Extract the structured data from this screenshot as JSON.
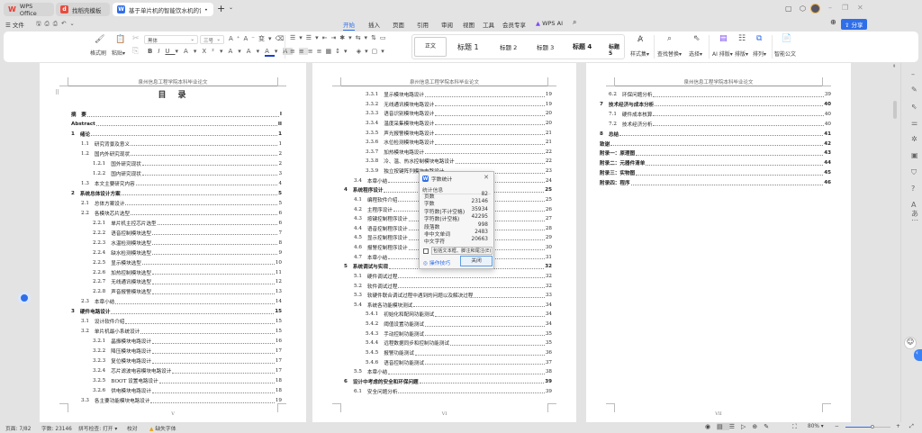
{
  "tabs": [
    {
      "label": "WPS Office",
      "icon": "wps-logo-icon",
      "color": "#e8392e"
    },
    {
      "label": "找稻壳模板",
      "icon": "docer-icon",
      "color": "#e84c3d"
    },
    {
      "label": "基于单片机的智能饮水机的设计",
      "icon": "word-doc-icon",
      "color": "#2f6ee8"
    }
  ],
  "menu": {
    "file": "文件",
    "tabs": [
      "开始",
      "插入",
      "页面",
      "引用",
      "审阅",
      "视图",
      "工具",
      "会员专享",
      "WPS AI"
    ],
    "active": "开始",
    "share": "分享"
  },
  "ribbon": {
    "format_painter": "格式刷",
    "paste": "粘贴",
    "font": "黑体",
    "size": "三号",
    "styles": [
      "正文",
      "标题 1",
      "标题 2",
      "标题 3",
      "标题 4",
      "标题 5"
    ],
    "style_set": "样式集",
    "find_replace": "查找替换",
    "select": "选择",
    "ai_layout": "AI 排版",
    "layout": "排版",
    "arrange": "排列",
    "smart_doc": "智能公文"
  },
  "doc": {
    "header": "泉州信息工程学院本科毕业论文",
    "toc_title": "目　录",
    "pages": [
      {
        "footer": "V",
        "rows": [
          {
            "l": 0,
            "n": "摘　要",
            "t": "",
            "p": "I",
            "b": true
          },
          {
            "l": 0,
            "n": "Abstract",
            "t": "",
            "p": "II",
            "b": true
          },
          {
            "l": 0,
            "n": "1",
            "t": "绪论",
            "p": "1",
            "b": true
          },
          {
            "l": 1,
            "n": "1.1",
            "t": "研究背景及意义",
            "p": "1"
          },
          {
            "l": 1,
            "n": "1.2",
            "t": "国内外研究现状",
            "p": "2"
          },
          {
            "l": 2,
            "n": "1.2.1",
            "t": "国外研究现状",
            "p": "2"
          },
          {
            "l": 2,
            "n": "1.2.2",
            "t": "国内研究现状",
            "p": "3"
          },
          {
            "l": 1,
            "n": "1.3",
            "t": "本文主要研究内容",
            "p": "4"
          },
          {
            "l": 0,
            "n": "2",
            "t": "系统总体设计方案",
            "p": "5",
            "b": true
          },
          {
            "l": 1,
            "n": "2.1",
            "t": "总体方案设计",
            "p": "5"
          },
          {
            "l": 1,
            "n": "2.2",
            "t": "各模块芯片选型",
            "p": "6"
          },
          {
            "l": 2,
            "n": "2.2.1",
            "t": "单片机主控芯片选型",
            "p": "6"
          },
          {
            "l": 2,
            "n": "2.2.2",
            "t": "语音控制模块选型",
            "p": "7"
          },
          {
            "l": 2,
            "n": "2.2.3",
            "t": "水温检测模块选型",
            "p": "8"
          },
          {
            "l": 2,
            "n": "2.2.4",
            "t": "缺水检测模块选型",
            "p": "9"
          },
          {
            "l": 2,
            "n": "2.2.5",
            "t": "显示模块选型",
            "p": "10"
          },
          {
            "l": 2,
            "n": "2.2.6",
            "t": "加热控制模块选型",
            "p": "11"
          },
          {
            "l": 2,
            "n": "2.2.7",
            "t": "无线通讯模块选型",
            "p": "12"
          },
          {
            "l": 2,
            "n": "2.2.8",
            "t": "声音报警模块选型",
            "p": "13"
          },
          {
            "l": 1,
            "n": "2.3",
            "t": "本章小结",
            "p": "14"
          },
          {
            "l": 0,
            "n": "3",
            "t": "硬件电路设计",
            "p": "15",
            "b": true
          },
          {
            "l": 1,
            "n": "3.1",
            "t": "设计软件介绍",
            "p": "15"
          },
          {
            "l": 1,
            "n": "3.2",
            "t": "单片机最小系统设计",
            "p": "15"
          },
          {
            "l": 2,
            "n": "3.2.1",
            "t": "晶振模块电路设计",
            "p": "16"
          },
          {
            "l": 2,
            "n": "3.2.2",
            "t": "降压模块电路设计",
            "p": "17"
          },
          {
            "l": 2,
            "n": "3.2.3",
            "t": "复位模块电路设计",
            "p": "17"
          },
          {
            "l": 2,
            "n": "3.2.4",
            "t": "芯片滤波电容模块电路设计",
            "p": "17"
          },
          {
            "l": 2,
            "n": "3.2.5",
            "t": "BOOT 设置电路设计",
            "p": "18"
          },
          {
            "l": 2,
            "n": "3.2.6",
            "t": "供电模块电路设计",
            "p": "18"
          },
          {
            "l": 1,
            "n": "3.3",
            "t": "各主要功能模块电路设计",
            "p": "19"
          }
        ]
      },
      {
        "footer": "VI",
        "rows": [
          {
            "l": 2,
            "n": "3.3.1",
            "t": "显示模块电路设计",
            "p": "19"
          },
          {
            "l": 2,
            "n": "3.3.2",
            "t": "无线通讯模块电路设计",
            "p": "19"
          },
          {
            "l": 2,
            "n": "3.3.3",
            "t": "语音识别模块电路设计",
            "p": "20"
          },
          {
            "l": 2,
            "n": "3.3.4",
            "t": "温度采集模块电路设计",
            "p": "20"
          },
          {
            "l": 2,
            "n": "3.3.5",
            "t": "声光报警模块电路设计",
            "p": "21"
          },
          {
            "l": 2,
            "n": "3.3.6",
            "t": "水位检测模块电路设计",
            "p": "21"
          },
          {
            "l": 2,
            "n": "3.3.7",
            "t": "加热模块电路设计",
            "p": "22"
          },
          {
            "l": 2,
            "n": "3.3.8",
            "t": "冷、温、热水控制模块电路设计",
            "p": "22"
          },
          {
            "l": 2,
            "n": "3.3.9",
            "t": "独立按键阵列模块电路设计",
            "p": "23"
          },
          {
            "l": 1,
            "n": "3.4",
            "t": "本章小结",
            "p": "24"
          },
          {
            "l": 0,
            "n": "4",
            "t": "系统程序设计",
            "p": "25",
            "b": true
          },
          {
            "l": 1,
            "n": "4.1",
            "t": "编程软件介绍",
            "p": "25"
          },
          {
            "l": 1,
            "n": "4.2",
            "t": "主程序设计",
            "p": "26"
          },
          {
            "l": 1,
            "n": "4.3",
            "t": "按键控制程序设计",
            "p": "27"
          },
          {
            "l": 1,
            "n": "4.4",
            "t": "语音控制程序设计",
            "p": "28"
          },
          {
            "l": 1,
            "n": "4.5",
            "t": "显示控制程序设计",
            "p": "29"
          },
          {
            "l": 1,
            "n": "4.6",
            "t": "报警控制程序设计",
            "p": "30"
          },
          {
            "l": 1,
            "n": "4.7",
            "t": "本章小结",
            "p": "31"
          },
          {
            "l": 0,
            "n": "5",
            "t": "系统调试与实现",
            "p": "32",
            "b": true
          },
          {
            "l": 1,
            "n": "5.1",
            "t": "硬件调试过程",
            "p": "32"
          },
          {
            "l": 1,
            "n": "5.2",
            "t": "软件调试过程",
            "p": "32"
          },
          {
            "l": 1,
            "n": "5.3",
            "t": "软硬件联合调试过程中遇到的问题以及解决过程",
            "p": "33"
          },
          {
            "l": 1,
            "n": "5.4",
            "t": "系统各功能模块测试",
            "p": "34"
          },
          {
            "l": 2,
            "n": "5.4.1",
            "t": "初始化和配网功能测试",
            "p": "34"
          },
          {
            "l": 2,
            "n": "5.4.2",
            "t": "阈值设置功能测试",
            "p": "34"
          },
          {
            "l": 2,
            "n": "5.4.3",
            "t": "手动控制功能测试",
            "p": "35"
          },
          {
            "l": 2,
            "n": "5.4.4",
            "t": "远程数据同步和控制功能测试",
            "p": "35"
          },
          {
            "l": 2,
            "n": "5.4.5",
            "t": "报警功能测试",
            "p": "36"
          },
          {
            "l": 2,
            "n": "5.4.6",
            "t": "语音控制功能测试",
            "p": "37"
          },
          {
            "l": 1,
            "n": "5.5",
            "t": "本章小结",
            "p": "38"
          },
          {
            "l": 0,
            "n": "6",
            "t": "设计中考虑的安全和环保问题",
            "p": "39",
            "b": true
          },
          {
            "l": 1,
            "n": "6.1",
            "t": "安全问题分析",
            "p": "39"
          }
        ]
      },
      {
        "footer": "VII",
        "rows": [
          {
            "l": 1,
            "n": "6.2",
            "t": "环保问题分析",
            "p": "39"
          },
          {
            "l": 0,
            "n": "7",
            "t": "技术经济与成本分析",
            "p": "40",
            "b": true
          },
          {
            "l": 1,
            "n": "7.1",
            "t": "硬件成本核算",
            "p": "40"
          },
          {
            "l": 1,
            "n": "7.2",
            "t": "技术经济分析",
            "p": "40"
          },
          {
            "l": 0,
            "n": "8",
            "t": "总结",
            "p": "41",
            "b": true
          },
          {
            "l": 0,
            "n": "致谢",
            "t": "",
            "p": "42",
            "b": true
          },
          {
            "l": 0,
            "n": "附录一：原理图",
            "t": "",
            "p": "43",
            "b": true
          },
          {
            "l": 0,
            "n": "附录二：元器件清单",
            "t": "",
            "p": "44",
            "b": true
          },
          {
            "l": 0,
            "n": "附录三：实物图",
            "t": "",
            "p": "45",
            "b": true
          },
          {
            "l": 0,
            "n": "附录四：程序",
            "t": "",
            "p": "46",
            "b": true
          }
        ]
      }
    ]
  },
  "dialog": {
    "title": "字数统计",
    "section": "统计信息",
    "stats": [
      {
        "k": "页数",
        "v": "82"
      },
      {
        "k": "字数",
        "v": "23146"
      },
      {
        "k": "字符数(不计空格)",
        "v": "35934"
      },
      {
        "k": "字符数(计空格)",
        "v": "42295"
      },
      {
        "k": "段落数",
        "v": "998"
      },
      {
        "k": "非中文单词",
        "v": "2483"
      },
      {
        "k": "中文字符",
        "v": "20663"
      }
    ],
    "checkbox": "包括文本框、脚注和尾注(E)",
    "tips": "操作技巧",
    "close": "关闭"
  },
  "status": {
    "page": "页面: 7/82",
    "words": "字数: 23146",
    "spell": "拼写检查: 打开",
    "proof": "校对",
    "missing_font": "缺失字体",
    "zoom": "80%",
    "zoom_fraction": 0.6
  }
}
